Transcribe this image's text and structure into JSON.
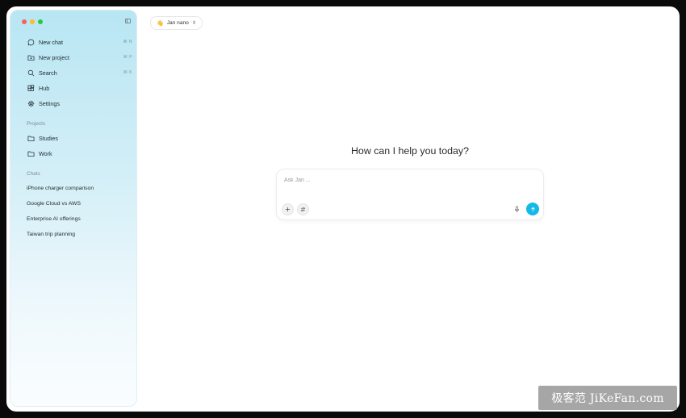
{
  "sidebar": {
    "nav": [
      {
        "label": "New chat",
        "icon": "message-circle-icon",
        "shortcut": "⌘ N"
      },
      {
        "label": "New project",
        "icon": "folder-plus-icon",
        "shortcut": "⌘ P"
      },
      {
        "label": "Search",
        "icon": "search-icon",
        "shortcut": "⌘ K"
      },
      {
        "label": "Hub",
        "icon": "blocks-icon",
        "shortcut": ""
      },
      {
        "label": "Settings",
        "icon": "gear-icon",
        "shortcut": ""
      }
    ],
    "projects_title": "Projects",
    "projects": [
      {
        "label": "Studies",
        "icon": "folder-icon"
      },
      {
        "label": "Work",
        "icon": "folder-icon"
      }
    ],
    "chats_title": "Chats",
    "chats": [
      "iPhone charger comparison",
      "Google Cloud vs AWS",
      "Enterprise AI offerings",
      "Taiwan trip planning"
    ]
  },
  "model_selector": {
    "emoji": "👋",
    "label": "Jan nano",
    "icon": "chevrons-up-down-icon"
  },
  "main": {
    "headline": "How can I help you today?",
    "composer": {
      "placeholder": "Ask Jan ...",
      "value": ""
    }
  },
  "watermark": "极客范 JiKeFan.com",
  "colors": {
    "accent": "#15b9e8",
    "traffic_close": "#ff5f57",
    "traffic_min": "#febc2e",
    "traffic_max": "#28c840"
  }
}
